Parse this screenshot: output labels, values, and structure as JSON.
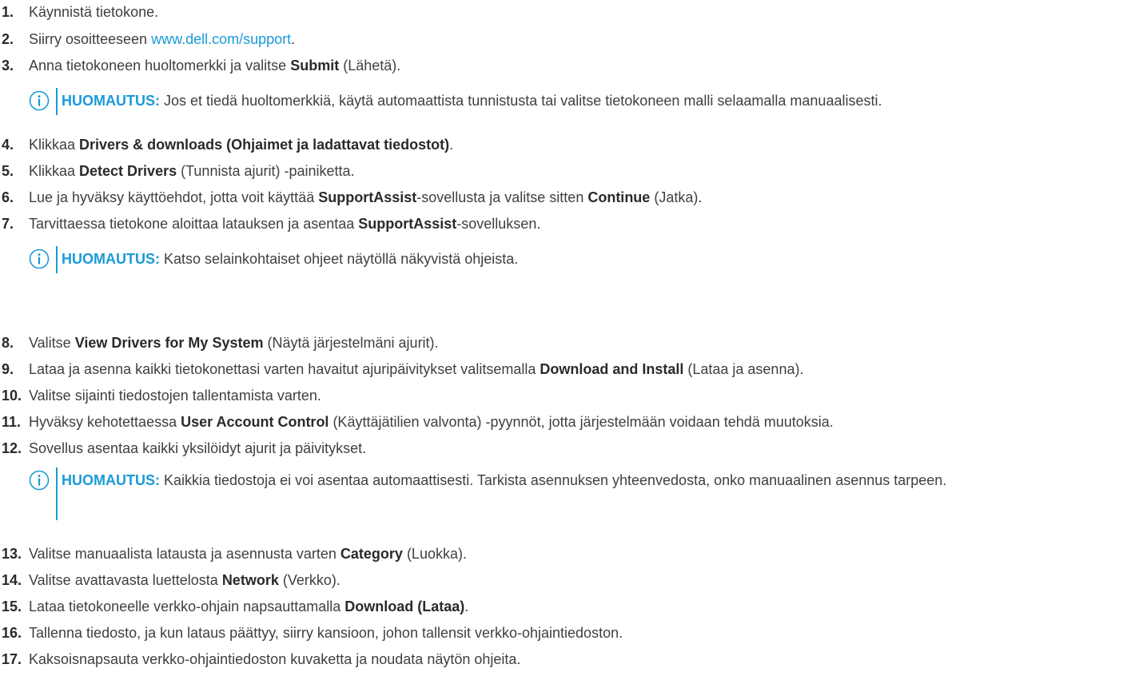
{
  "steps": [
    {
      "num": "1.",
      "pre": "Käynnistä tietokone.",
      "bold": "",
      "post": ""
    },
    {
      "num": "2.",
      "pre": "Siirry osoitteeseen ",
      "link": "www.dell.com/support",
      "post": "."
    },
    {
      "num": "3.",
      "pre": "Anna tietokoneen huoltomerkki ja valitse ",
      "bold": "Submit",
      "post": " (Lähetä)."
    },
    {
      "num": "4.",
      "pre": "Klikkaa ",
      "bold": "Drivers & downloads (Ohjaimet ja ladattavat tiedostot)",
      "post": "."
    },
    {
      "num": "5.",
      "pre": "Klikkaa ",
      "bold": "Detect Drivers",
      "post": " (Tunnista ajurit) -painiketta."
    },
    {
      "num": "6.",
      "pre": "Lue ja hyväksy käyttöehdot, jotta voit käyttää ",
      "bold": "SupportAssist",
      "mid": "-sovellusta ja valitse sitten ",
      "bold2": "Continue",
      "post": " (Jatka)."
    },
    {
      "num": "7.",
      "pre": "Tarvittaessa tietokone aloittaa latauksen ja asentaa ",
      "bold": "SupportAssist",
      "post": "-sovelluksen."
    },
    {
      "num": "8.",
      "pre": "Valitse ",
      "bold": "View Drivers for My System",
      "post": " (Näytä järjestelmäni ajurit)."
    },
    {
      "num": "9.",
      "pre": "Lataa ja asenna kaikki tietokonettasi varten havaitut ajuripäivitykset valitsemalla ",
      "bold": "Download and Install",
      "post": " (Lataa ja asenna)."
    },
    {
      "num": "10.",
      "pre": "Valitse sijainti tiedostojen tallentamista varten.",
      "bold": "",
      "post": ""
    },
    {
      "num": "11.",
      "pre": "Hyväksy kehotettaessa ",
      "bold": "User Account Control",
      "post": " (Käyttäjätilien valvonta) -pyynnöt, jotta järjestelmään voidaan tehdä muutoksia."
    },
    {
      "num": "12.",
      "pre": "Sovellus asentaa kaikki yksilöidyt ajurit ja päivitykset.",
      "bold": "",
      "post": ""
    },
    {
      "num": "13.",
      "pre": "Valitse manuaalista latausta ja asennusta varten ",
      "bold": "Category",
      "post": " (Luokka)."
    },
    {
      "num": "14.",
      "pre": "Valitse avattavasta luettelosta ",
      "bold": "Network",
      "post": " (Verkko)."
    },
    {
      "num": "15.",
      "pre": "Lataa tietokoneelle verkko-ohjain napsauttamalla ",
      "bold": "Download (Lataa)",
      "post": "."
    },
    {
      "num": "16.",
      "pre": "Tallenna tiedosto, ja kun lataus päättyy, siirry kansioon, johon tallensit verkko-ohjaintiedoston.",
      "bold": "",
      "post": ""
    },
    {
      "num": "17.",
      "pre": "Kaksoisnapsauta verkko-ohjaintiedoston kuvaketta ja noudata näytön ohjeita.",
      "bold": "",
      "post": ""
    }
  ],
  "notes": [
    {
      "label": "HUOMAUTUS:",
      "text": " Jos et tiedä huoltomerkkiä, käytä automaattista tunnistusta tai valitse tietokoneen malli selaamalla manuaalisesti."
    },
    {
      "label": "HUOMAUTUS:",
      "text": " Katso selainkohtaiset ohjeet näytöllä näkyvistä ohjeista."
    },
    {
      "label": "HUOMAUTUS:",
      "text": " Kaikkia tiedostoja ei voi asentaa automaattisesti. Tarkista asennuksen yhteenvedosta, onko manuaalinen asennus tarpeen."
    }
  ],
  "colors": {
    "accent": "#1a9ad7",
    "text": "#3f3f3f"
  },
  "icons": {
    "note": "info-icon"
  }
}
